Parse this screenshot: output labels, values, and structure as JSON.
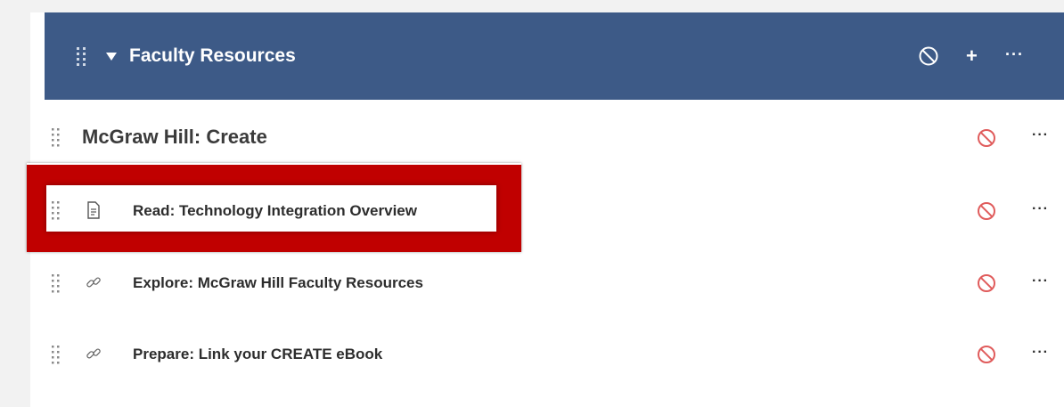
{
  "module": {
    "title": "Faculty Resources",
    "header_icons": {
      "drag": "drag-handle-icon",
      "collapse": "caret-down-icon",
      "unpublished": "unpublished-circle-icon",
      "add": "+",
      "more": "···"
    },
    "items": [
      {
        "label": "McGraw Hill: Create",
        "kind": "subheader",
        "icon": "",
        "status": "unpublished",
        "more": "···"
      },
      {
        "label": "Read: Technology Integration Overview",
        "kind": "page",
        "icon": "document-icon",
        "status": "unpublished",
        "more": "···"
      },
      {
        "label": "Explore: McGraw Hill Faculty Resources",
        "kind": "link",
        "icon": "link-icon",
        "status": "unpublished",
        "more": "···"
      },
      {
        "label": "Prepare: Link your CREATE eBook",
        "kind": "link",
        "icon": "link-icon",
        "status": "unpublished",
        "more": "···"
      }
    ]
  },
  "colors": {
    "header_bg": "#3d5a87",
    "highlight": "#c00000",
    "unpublished": "#e05c5c"
  }
}
